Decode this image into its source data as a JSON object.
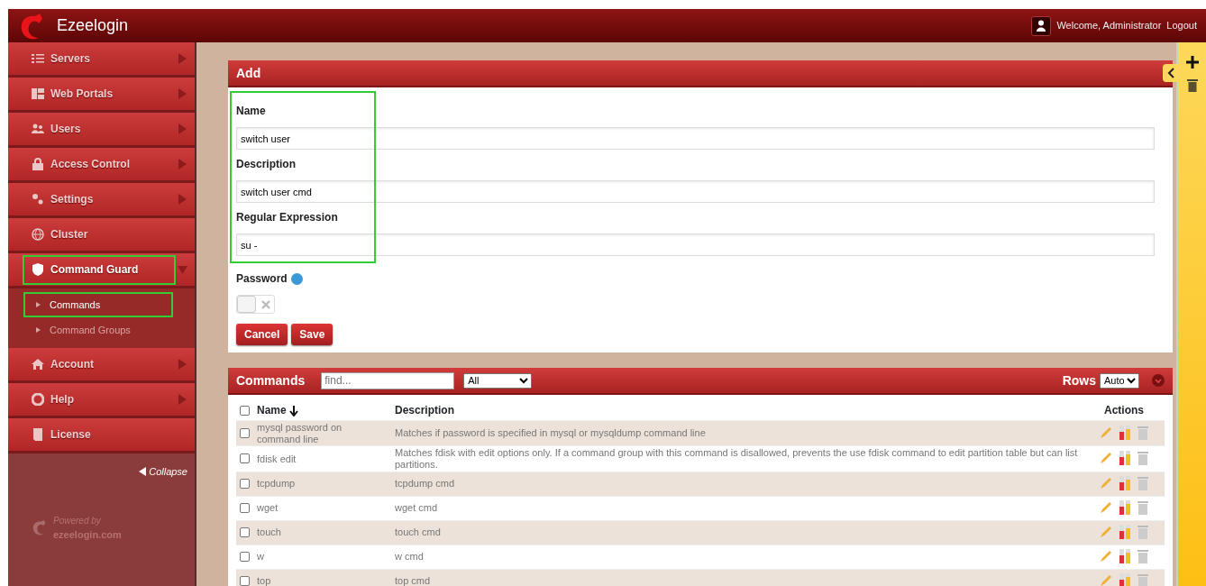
{
  "header": {
    "brand": "Ezeelogin",
    "welcome": "Welcome, Administrator",
    "logout": "Logout"
  },
  "sidebar": {
    "items": [
      {
        "label": "Servers",
        "expanded": false,
        "highlighted": false
      },
      {
        "label": "Web Portals",
        "expanded": false,
        "highlighted": false
      },
      {
        "label": "Users",
        "expanded": false,
        "highlighted": false
      },
      {
        "label": "Access Control",
        "expanded": false,
        "highlighted": false
      },
      {
        "label": "Settings",
        "expanded": false,
        "highlighted": false
      },
      {
        "label": "Cluster",
        "highlighted": false
      },
      {
        "label": "Command Guard",
        "expanded": true,
        "highlighted": true,
        "children": [
          {
            "label": "Commands",
            "selected": true,
            "highlighted": true
          },
          {
            "label": "Command Groups",
            "selected": false,
            "highlighted": false
          }
        ]
      },
      {
        "label": "Account",
        "expanded": false,
        "highlighted": false
      },
      {
        "label": "Help",
        "expanded": false,
        "highlighted": false
      },
      {
        "label": "License",
        "highlighted": false
      }
    ],
    "collapse": "Collapse",
    "powered_by": "Powered by",
    "powered_site": "ezeelogin.com"
  },
  "add_panel": {
    "title": "Add",
    "fields_highlighted": true,
    "fields": [
      {
        "label": "Name",
        "value": "switch user"
      },
      {
        "label": "Description",
        "value": "switch user cmd"
      },
      {
        "label": "Regular Expression",
        "value": "su -"
      }
    ],
    "password": {
      "label": "Password",
      "on": false
    },
    "buttons": [
      "Cancel",
      "Save"
    ]
  },
  "commands_panel": {
    "title": "Commands",
    "search": {
      "placeholder": "find..."
    },
    "filter": "All",
    "rows_label": "Rows",
    "rows_value": "Auto",
    "columns": [
      "Name",
      "Description",
      "Actions"
    ],
    "select_all_checked": false,
    "rows": [
      {
        "name": "mysql password on command line",
        "description": "Matches if password is specified in mysql or mysqldump command line",
        "checked": false
      },
      {
        "name": "fdisk edit",
        "description": "Matches fdisk with edit options only. If a command group with this command is disallowed, prevents the use fdisk command to edit partition table but can list partitions.",
        "checked": false
      },
      {
        "name": "tcpdump",
        "description": "tcpdump cmd",
        "checked": false
      },
      {
        "name": "wget",
        "description": "wget cmd",
        "checked": false
      },
      {
        "name": "touch",
        "description": "touch cmd",
        "checked": false
      },
      {
        "name": "w",
        "description": "w cmd",
        "checked": false
      },
      {
        "name": "top",
        "description": "top cmd",
        "checked": false
      }
    ]
  }
}
